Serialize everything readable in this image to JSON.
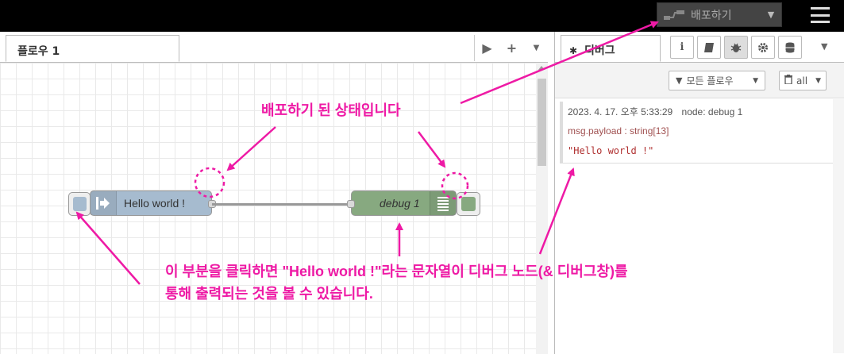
{
  "header": {
    "deploy_label": "배포하기",
    "deploy_icon": "deploy-icon",
    "menu_icon": "hamburger-menu-icon"
  },
  "workspace": {
    "tab_label": "플로우 1",
    "tools": [
      "play-icon",
      "plus-icon",
      "caret-down-icon"
    ],
    "nodes": {
      "inject_label": "Hello world !",
      "debug_label": "debug 1"
    }
  },
  "sidebar": {
    "tab_label": "디버그",
    "tab_icons": [
      "info-icon",
      "book-icon",
      "bug-icon",
      "gear-icon",
      "database-icon"
    ],
    "filter_label": "모든 플로우",
    "clear_label": "all",
    "message": {
      "timestamp": "2023. 4. 17. 오후 5:33:29",
      "node": "node: debug 1",
      "path": "msg.payload : string[13]",
      "payload": "\"Hello world !\""
    }
  },
  "annotations": {
    "deployed": "배포하기 된 상태입니다",
    "line1": "이 부분을 클릭하면 \"Hello world !\"라는 문자열이 디버그 노드(& 디버그창)를",
    "line2": "통해 출력되는 것을 볼 수 있습니다."
  },
  "colors": {
    "annotation": "#ee1aa5",
    "inject_node": "#a6bbcf",
    "debug_node": "#87a980",
    "topbar": "#000000"
  }
}
